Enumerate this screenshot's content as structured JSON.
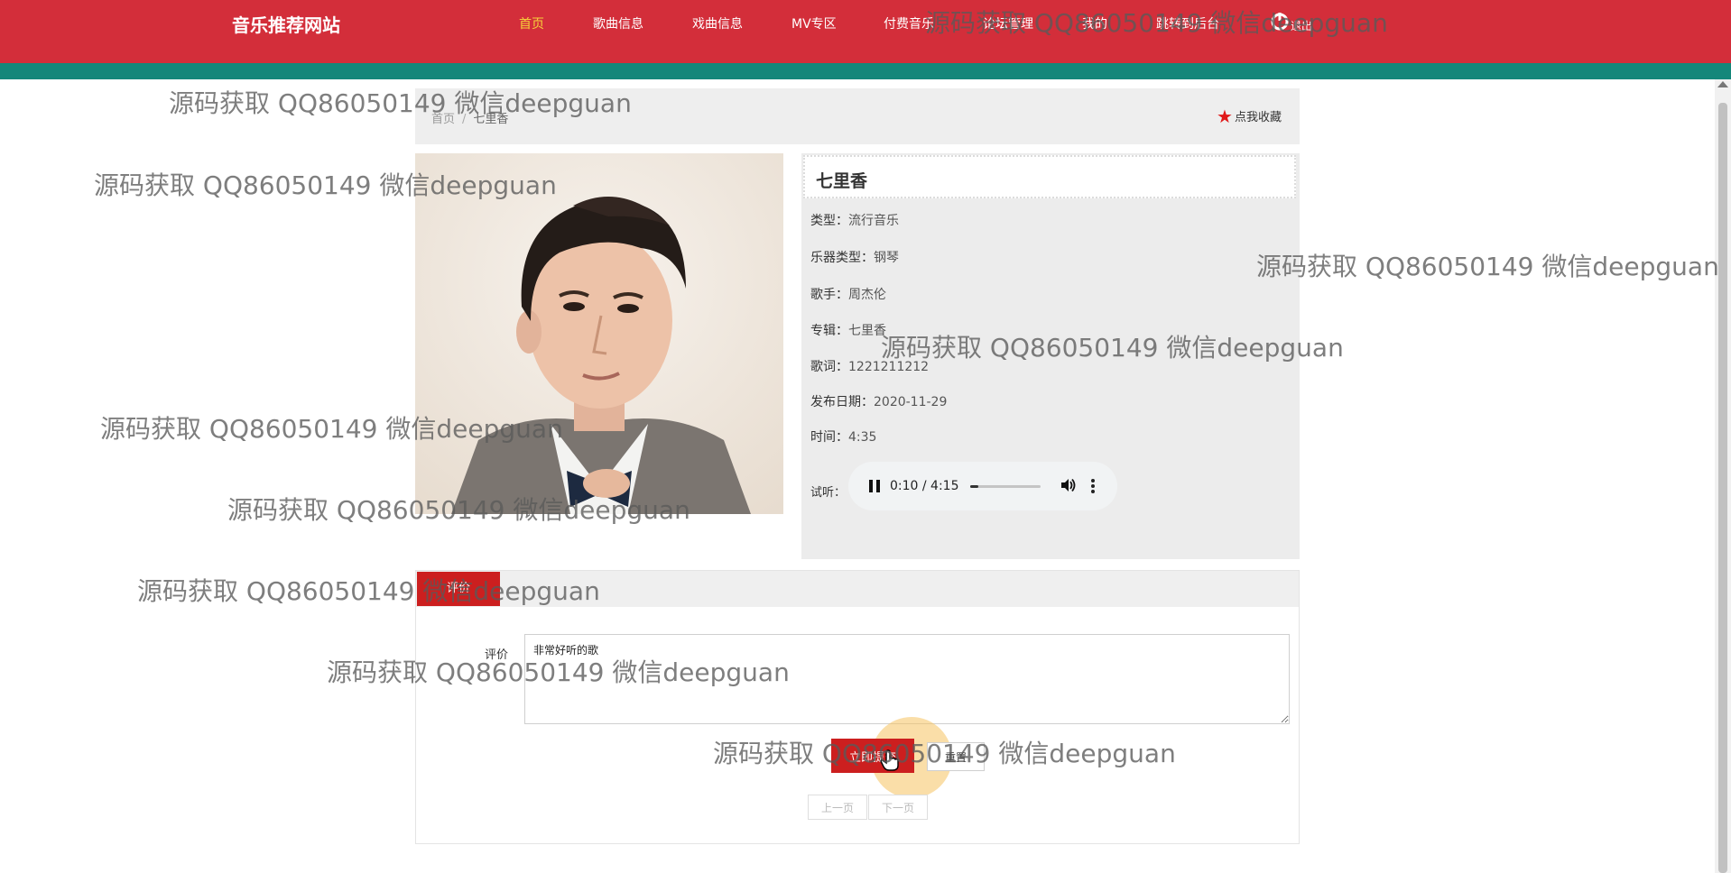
{
  "brand": "音乐推荐网站",
  "nav": {
    "items": [
      {
        "label": "首页",
        "active": true
      },
      {
        "label": "歌曲信息",
        "active": false
      },
      {
        "label": "戏曲信息",
        "active": false
      },
      {
        "label": "MV专区",
        "active": false
      },
      {
        "label": "付费音乐",
        "active": false
      },
      {
        "label": "论坛管理",
        "active": false
      },
      {
        "label": "我的",
        "active": false
      },
      {
        "label": "跳转到后台",
        "active": false
      }
    ],
    "logout_label": "退出"
  },
  "breadcrumb": {
    "home": "首页",
    "separator": "/",
    "current": "七里香"
  },
  "favorite_label": "点我收藏",
  "song": {
    "title": "七里香",
    "fields": [
      {
        "label": "类型：",
        "value": "流行音乐"
      },
      {
        "label": "乐器类型：",
        "value": "钢琴"
      },
      {
        "label": "歌手：",
        "value": "周杰伦"
      },
      {
        "label": "专辑：",
        "value": "七里香"
      },
      {
        "label": "歌词：",
        "value": "1221211212"
      },
      {
        "label": "发布日期：",
        "value": "2020-11-29"
      },
      {
        "label": "时间：",
        "value": "4:35"
      }
    ],
    "audio_label": "试听：",
    "audio_time": "0:10 / 4:15",
    "audio_progress": 0.04
  },
  "comments": {
    "tab_label": "评价",
    "field_label": "评价",
    "field_value": "非常好听的歌",
    "submit_label": "立即提交",
    "reset_label": "重置",
    "prev_label": "上一页",
    "next_label": "下一页"
  },
  "watermark_text": "源码获取 QQ86050149 微信deepguan",
  "colors": {
    "header_red": "#d32e3a",
    "stripe_teal": "#14877a",
    "active_nav": "#f6d23a",
    "button_red": "#cc1f1f"
  }
}
